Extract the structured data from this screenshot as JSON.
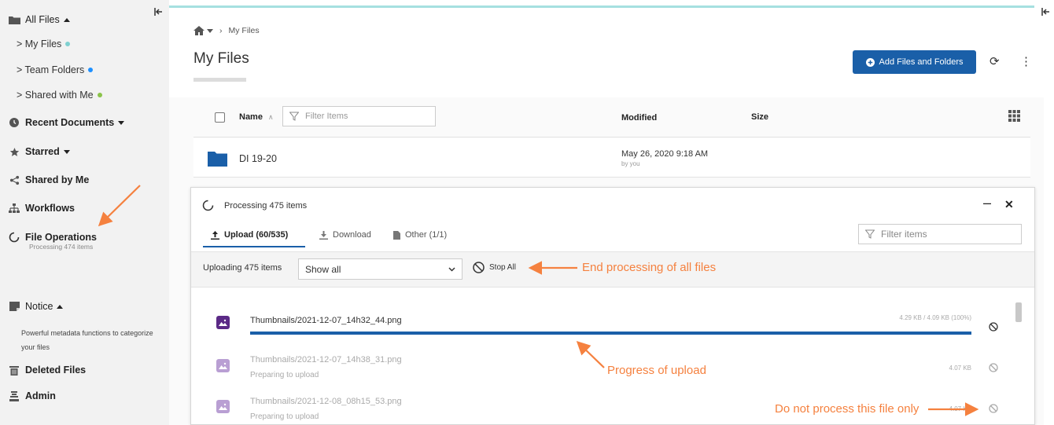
{
  "sidebar": {
    "all_files": "All Files",
    "sub_items": [
      {
        "label": "> My Files",
        "dot_color": "#7fd0d0"
      },
      {
        "label": "> Team Folders",
        "dot_color": "#1e90ff"
      },
      {
        "label": "> Shared with Me",
        "dot_color": "#8bc34a"
      }
    ],
    "recent": "Recent Documents",
    "starred": "Starred",
    "shared_by_me": "Shared by Me",
    "workflows": "Workflows",
    "file_operations": "File Operations",
    "file_operations_sub": "Processing 474 items",
    "notice": "Notice",
    "notice_text": "Powerful metadata functions to categorize your files",
    "deleted": "Deleted Files",
    "admin": "Admin"
  },
  "header": {
    "breadcrumb_current": "My Files",
    "title": "My Files",
    "add_button": "Add Files and Folders"
  },
  "list": {
    "col_name": "Name",
    "filter_placeholder": "Filter Items",
    "col_modified": "Modified",
    "col_size": "Size",
    "rows": [
      {
        "name": "DI 19-20",
        "modified": "May 26, 2020 9:18 AM",
        "by": "by you"
      }
    ]
  },
  "processing": {
    "title": "Processing 475 items",
    "tabs": {
      "upload": "Upload (60/535)",
      "download": "Download",
      "other": "Other (1/1)"
    },
    "filter_placeholder": "Filter items",
    "uploading_label": "Uploading 475 items",
    "select_value": "Show all",
    "stop_all": "Stop All",
    "uploads": [
      {
        "name": "Thumbnails/2021-12-07_14h32_44.png",
        "size": "4.29 KB / 4.09 KB (100%)",
        "status": "",
        "progress": 1.0
      },
      {
        "name": "Thumbnails/2021-12-07_14h38_31.png",
        "size": "4.07 KB",
        "status": "Preparing to upload"
      },
      {
        "name": "Thumbnails/2021-12-08_08h15_53.png",
        "size": "4.07 KB",
        "status": "Preparing to upload"
      }
    ]
  },
  "annotations": {
    "end_processing": "End processing of all files",
    "progress": "Progress of upload",
    "do_not_process": "Do not process this file only"
  },
  "colors": {
    "accent": "#1a5fa8",
    "annotation": "#f5813f",
    "upload_icon": "#5b2a86"
  }
}
